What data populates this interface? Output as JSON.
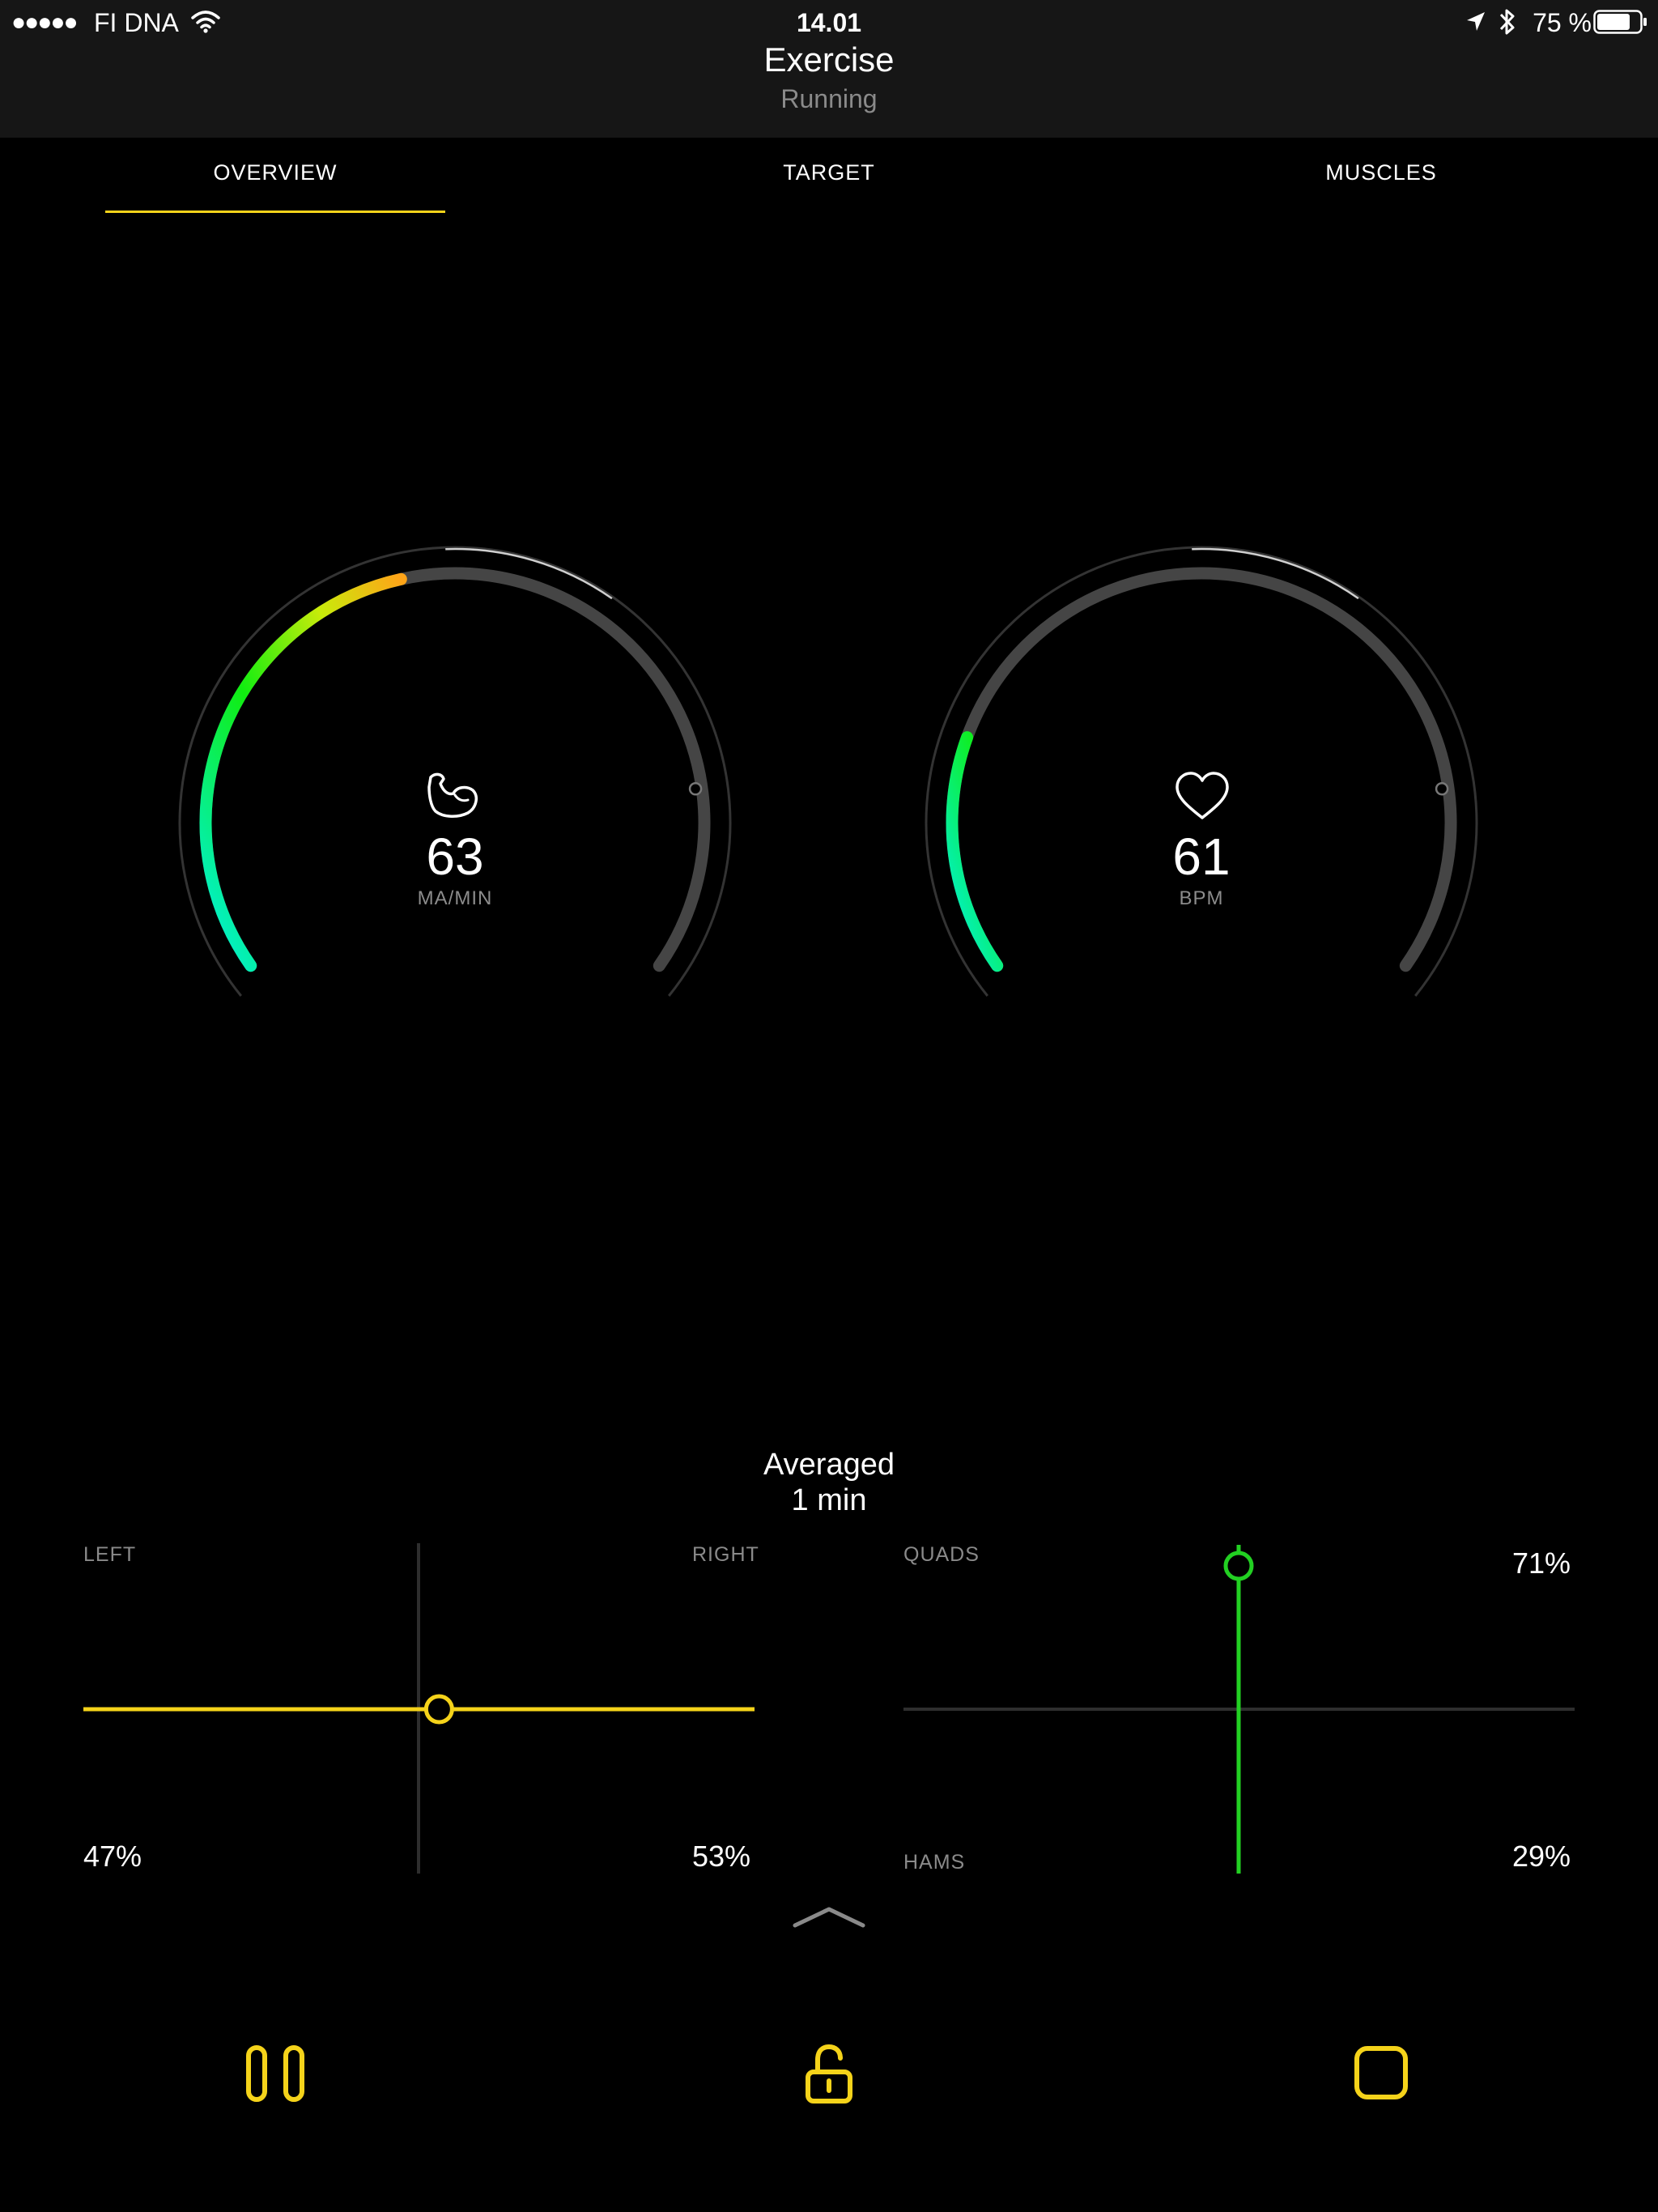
{
  "status_bar": {
    "signal": "●●●●●",
    "carrier": "FI DNA",
    "time": "14.01",
    "battery_percent": "75 %",
    "icons": [
      "wifi-icon",
      "location-arrow-icon",
      "bluetooth-icon",
      "battery-icon"
    ]
  },
  "header": {
    "title": "Exercise",
    "subtitle": "Running"
  },
  "tabs": [
    {
      "label": "OVERVIEW",
      "active": true
    },
    {
      "label": "TARGET",
      "active": false
    },
    {
      "label": "MUSCLES",
      "active": false
    }
  ],
  "gauges": [
    {
      "icon": "flexed-arm-icon",
      "value": "63",
      "unit": "MA/MIN",
      "fill_fraction": 0.45
    },
    {
      "icon": "heart-icon",
      "value": "61",
      "unit": "BPM",
      "fill_fraction": 0.22
    }
  ],
  "averaged": {
    "line1": "Averaged",
    "line2": "1 min"
  },
  "balance_left_right": {
    "left_label": "LEFT",
    "right_label": "RIGHT",
    "left_pct": "47%",
    "right_pct": "53%",
    "balance_fraction": 0.53
  },
  "balance_quads_hams": {
    "top_label": "QUADS",
    "bottom_label": "HAMS",
    "top_pct": "71%",
    "bottom_pct": "29%",
    "balance_fraction": 0.71
  },
  "controls": {
    "expand_icon": "chevron-up-icon",
    "buttons": [
      "pause-icon",
      "unlock-icon",
      "stop-icon"
    ]
  },
  "colors": {
    "accent": "#f5d31a",
    "green": "#22d022",
    "track": "#454545",
    "background": "#000000",
    "header_bg": "#161616"
  }
}
